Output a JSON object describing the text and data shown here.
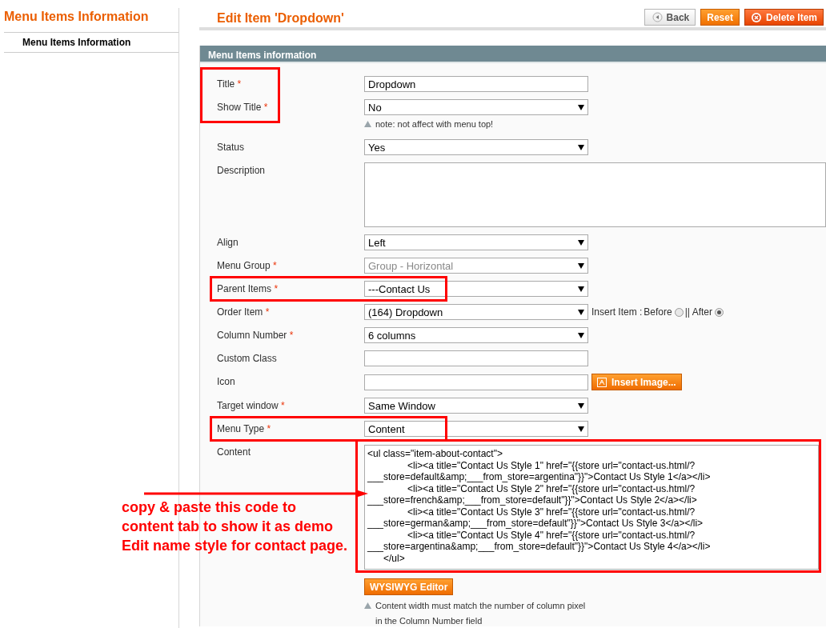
{
  "sidebar": {
    "title": "Menu Items Information",
    "items": [
      {
        "label": "Menu Items Information",
        "selected": true
      }
    ]
  },
  "header": {
    "title": "Edit Item 'Dropdown'",
    "buttons": [
      {
        "kind": "back",
        "label": "Back"
      },
      {
        "kind": "reset",
        "label": "Reset"
      },
      {
        "kind": "delete",
        "label": "Delete Item"
      }
    ]
  },
  "panel": {
    "title": "Menu Items information",
    "rows": [
      {
        "label": "Title",
        "mark": "*",
        "kind": "text",
        "value": "Dropdown",
        "highlighted": true
      },
      {
        "label": "Show Title",
        "mark": "*",
        "kind": "select",
        "value": "No",
        "note": "note: not affect with menu top!",
        "highlighted": true
      },
      {
        "label": "Status",
        "kind": "select",
        "value": "Yes"
      },
      {
        "label": "Description",
        "kind": "textarea"
      },
      {
        "label": "Align",
        "kind": "select",
        "value": "Left"
      },
      {
        "label": "Menu Group",
        "mark": "*",
        "kind": "select",
        "value": "Group - Horizontal",
        "disabled": true
      },
      {
        "label": "Parent Items",
        "mark": "*",
        "kind": "select",
        "value": "---Contact Us",
        "highlighted": true,
        "highlight_covers_value": true
      },
      {
        "label": "Order Item",
        "mark": "*",
        "kind": "select",
        "value": "(164) Dropdown",
        "insert": {
          "label": "Insert Item :",
          "options": [
            {
              "label": "Before",
              "selected": false
            },
            {
              "label": "|| After",
              "selected": true
            }
          ]
        }
      },
      {
        "label": "Column Number",
        "mark": "*",
        "kind": "select",
        "value": "6 columns"
      },
      {
        "label": "Custom Class",
        "kind": "text"
      },
      {
        "label": "Icon",
        "kind": "text",
        "button": "Insert Image..."
      },
      {
        "label": "Target window",
        "mark": "*",
        "kind": "select",
        "value": "Same Window"
      },
      {
        "label": "Menu Type",
        "mark": "*",
        "kind": "select",
        "value": "Content",
        "highlighted": true,
        "highlight_covers_value": true
      },
      {
        "label": "Content",
        "kind": "code",
        "value": "<ul class=\"item-about-contact\">\n\t<li><a title=\"Contact Us Style 1\" href=\"{{store url=\"contact-us.html/?\n___store=default&amp;___from_store=argentina\"}}\">Contact Us Style 1</a></li>\n\t<li><a title=\"Contact Us Style 2\" href=\"{{store url=\"contact-us.html/?\n___store=french&amp;___from_store=default\"}}\">Contact Us Style 2</a></li>\n\t<li><a title=\"Contact Us Style 3\" href=\"{{store url=\"contact-us.html/?\n___store=german&amp;___from_store=default\"}}\">Contact Us Style 3</a></li>\n\t<li><a title=\"Contact Us Style 4\" href=\"{{store url=\"contact-us.html/?\n___store=argentina&amp;___from_store=default\"}}\">Contact Us Style 4</a></li>\n      </ul>",
        "highlighted": true,
        "button": "WYSIWYG Editor",
        "note": "Content width must match the number of column pixel\nin the Column Number field"
      }
    ]
  },
  "annotation": {
    "text": "copy & paste this code to\ncontent tab to show it as demo\nEdit name style for contact page."
  }
}
